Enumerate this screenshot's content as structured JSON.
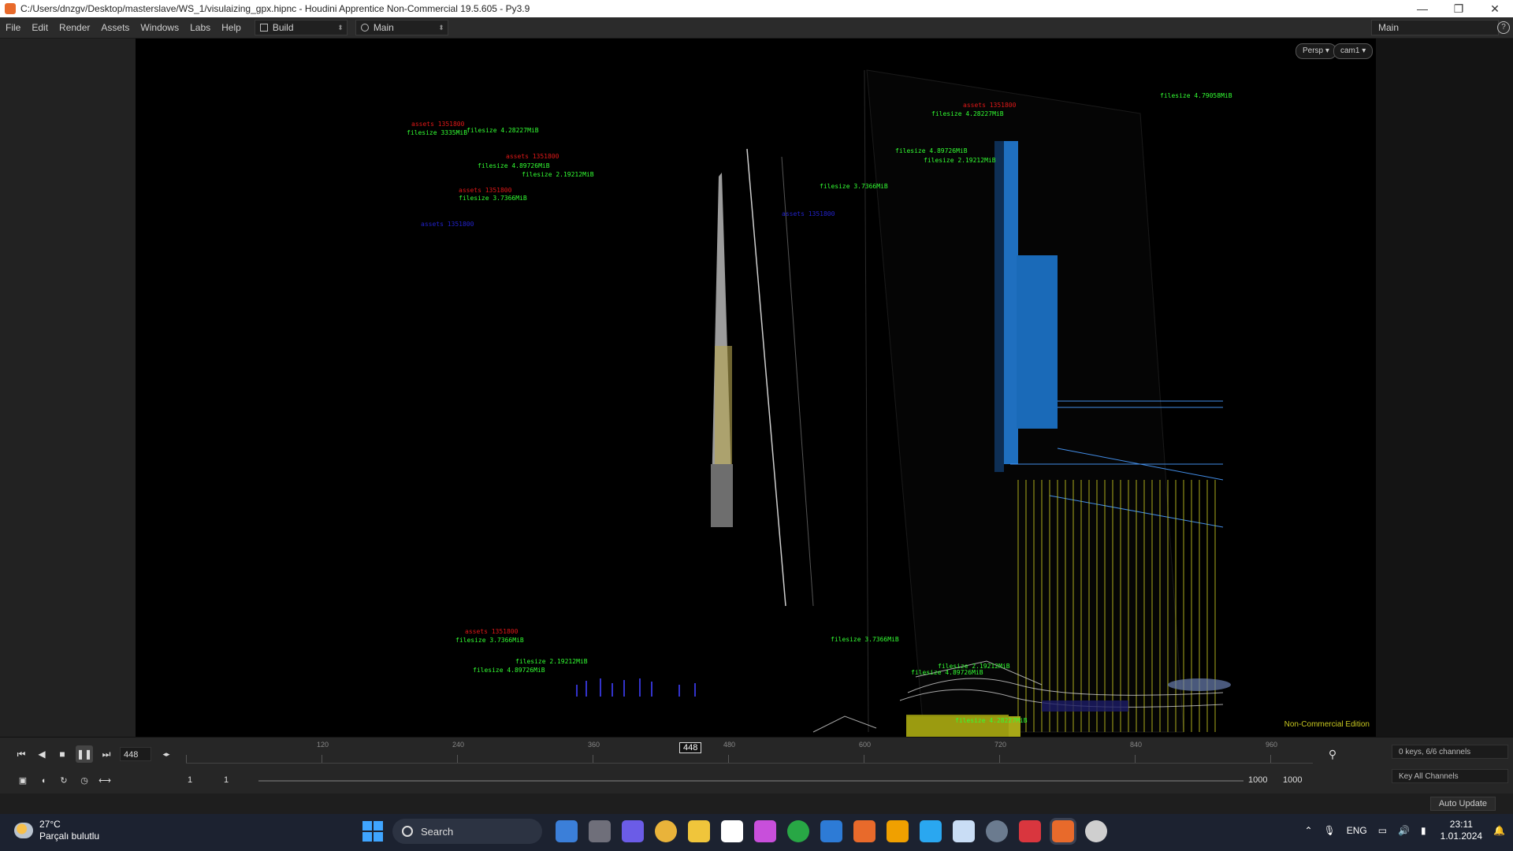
{
  "window": {
    "title": "C:/Users/dnzgv/Desktop/masterslave/WS_1/visulaizing_gpx.hipnc - Houdini Apprentice Non-Commercial 19.5.605 - Py3.9",
    "minimize": "—",
    "maximize": "❐",
    "close": "✕"
  },
  "menu": {
    "items": [
      "File",
      "Edit",
      "Render",
      "Assets",
      "Windows",
      "Labs",
      "Help"
    ],
    "desktop_build": "Build",
    "desktop_main": "Main",
    "right_desktop": "Main"
  },
  "viewport": {
    "camera_mode": "Persp ▾",
    "camera": "cam1 ▾",
    "watermark": "Non-Commercial Edition",
    "labels": [
      {
        "cls": "red",
        "text": "assets  1351800"
      },
      {
        "cls": "green",
        "text": "filesize  3335MiB"
      },
      {
        "cls": "green",
        "text": "filesize  4.28227MiB"
      },
      {
        "cls": "red",
        "text": "assets  1351800"
      },
      {
        "cls": "green",
        "text": "filesize  4.89726MiB"
      },
      {
        "cls": "green",
        "text": "filesize  2.19212MiB"
      },
      {
        "cls": "red",
        "text": "assets  1351800"
      },
      {
        "cls": "green",
        "text": "filesize  3.7366MiB"
      },
      {
        "cls": "blue",
        "text": "assets  1351800"
      },
      {
        "cls": "red",
        "text": "assets  1351800"
      },
      {
        "cls": "green",
        "text": "filesize  4.28227MiB"
      },
      {
        "cls": "green",
        "text": "filesize  4.89726MiB"
      },
      {
        "cls": "green",
        "text": "filesize  2.19212MiB"
      },
      {
        "cls": "green",
        "text": "filesize  3.7366MiB"
      },
      {
        "cls": "blue",
        "text": "assets  1351800"
      },
      {
        "cls": "green",
        "text": "filesize  4.79058MiB"
      },
      {
        "cls": "red",
        "text": "assets  1351800"
      },
      {
        "cls": "green",
        "text": "filesize  3.7366MiB"
      },
      {
        "cls": "green",
        "text": "filesize  2.19212MiB"
      },
      {
        "cls": "green",
        "text": "filesize  4.89726MiB"
      },
      {
        "cls": "green",
        "text": "filesize  3.7366MiB"
      },
      {
        "cls": "green",
        "text": "filesize  2.19212MiB"
      },
      {
        "cls": "green",
        "text": "filesize  4.89726MiB"
      },
      {
        "cls": "green",
        "text": "filesize  4.28227MiB"
      }
    ]
  },
  "timeline": {
    "current_frame": "448",
    "marker_frame": "448",
    "ticks": [
      "120",
      "240",
      "360",
      "480",
      "600",
      "720",
      "840",
      "960"
    ],
    "start": "1",
    "start2": "1",
    "end": "1000",
    "end2": "1000",
    "keys_info": "0 keys, 6/6 channels",
    "key_all": "Key All Channels",
    "auto_update": "Auto Update"
  },
  "taskbar": {
    "temperature": "27°C",
    "weather": "Parçalı bulutlu",
    "search": "Search",
    "language": "ENG",
    "time": "23:11",
    "date": "1.01.2024",
    "apps": [
      "#3b7fd9",
      "#6f6f7a",
      "#6b5ce7",
      "#e9b33a",
      "#f0c53b",
      "#ffffff",
      "#c84fdb",
      "#28a745",
      "#2d7bd6",
      "#e86a2b",
      "#f0a000",
      "#2aa7f0",
      "#c9ddf5",
      "#6b7b8f",
      "#d9363e",
      "#e86a2b",
      "#cfcfcf"
    ]
  }
}
